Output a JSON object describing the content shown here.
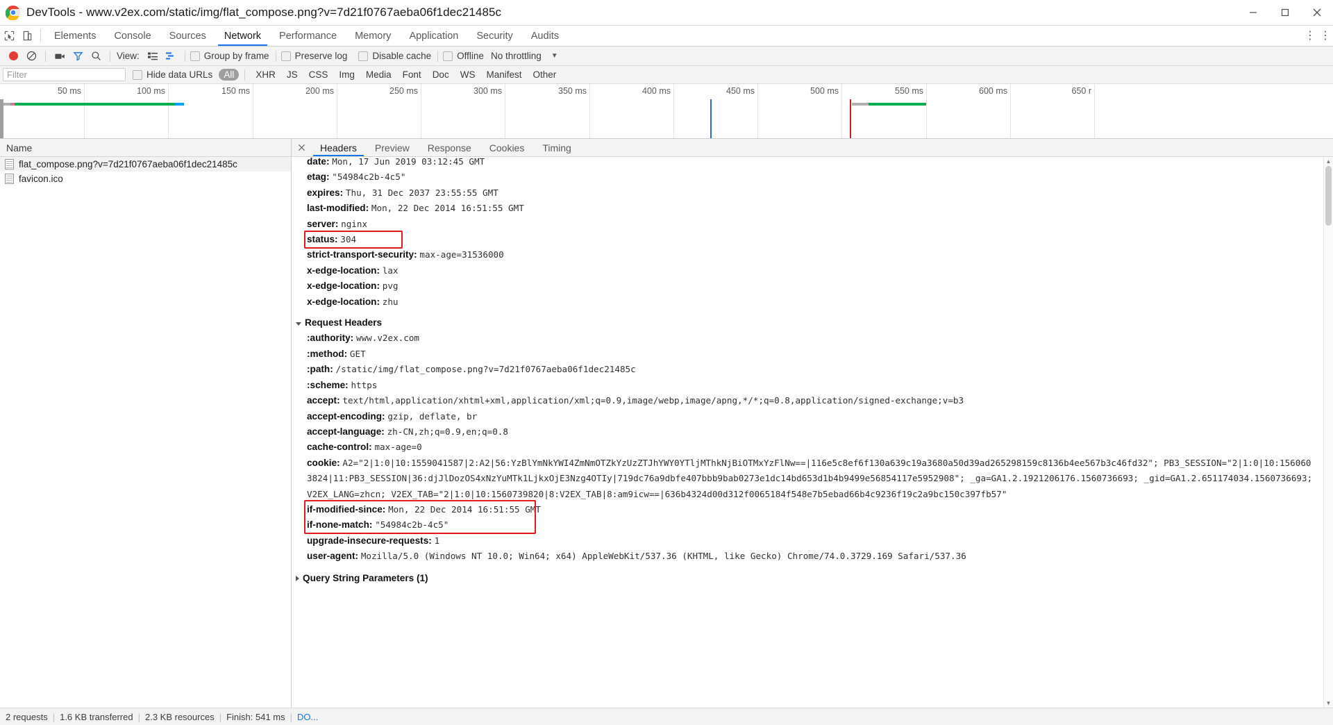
{
  "window": {
    "title": "DevTools - www.v2ex.com/static/img/flat_compose.png?v=7d21f0767aeba06f1dec21485c",
    "logo_icon": "chrome-logo-icon",
    "minimize_label": "Minimize",
    "maximize_label": "Maximize",
    "close_label": "Close"
  },
  "main_tabs": {
    "inspect_icon": "inspect-element-icon",
    "device_icon": "toggle-device-toolbar-icon",
    "items": [
      {
        "label": "Elements",
        "active": false
      },
      {
        "label": "Console",
        "active": false
      },
      {
        "label": "Sources",
        "active": false
      },
      {
        "label": "Network",
        "active": true
      },
      {
        "label": "Performance",
        "active": false
      },
      {
        "label": "Memory",
        "active": false
      },
      {
        "label": "Application",
        "active": false
      },
      {
        "label": "Security",
        "active": false
      },
      {
        "label": "Audits",
        "active": false
      }
    ],
    "more_icon": "more-vertical-icon",
    "menu_icon": "customize-devtools-icon"
  },
  "network_toolbar": {
    "record_icon": "record-stop-icon",
    "clear_icon": "clear-icon",
    "capture_screenshots_icon": "camera-icon",
    "filter_icon": "funnel-icon",
    "search_icon": "search-icon",
    "view_label": "View:",
    "list_view_icon": "list-view-icon",
    "waterfall_view_icon": "waterfall-view-icon",
    "group_by_frame_label": "Group by frame",
    "preserve_log_label": "Preserve log",
    "disable_cache_label": "Disable cache",
    "offline_label": "Offline",
    "throttling_label": "No throttling",
    "throttling_caret_icon": "chevron-down-icon"
  },
  "filter_bar": {
    "filter_placeholder": "Filter",
    "filter_value": "",
    "hide_data_urls_label": "Hide data URLs",
    "types": [
      {
        "label": "All",
        "active": true
      },
      {
        "label": "XHR",
        "active": false
      },
      {
        "label": "JS",
        "active": false
      },
      {
        "label": "CSS",
        "active": false
      },
      {
        "label": "Img",
        "active": false
      },
      {
        "label": "Media",
        "active": false
      },
      {
        "label": "Font",
        "active": false
      },
      {
        "label": "Doc",
        "active": false
      },
      {
        "label": "WS",
        "active": false
      },
      {
        "label": "Manifest",
        "active": false
      },
      {
        "label": "Other",
        "active": false
      }
    ]
  },
  "overview": {
    "ticks": [
      "50 ms",
      "100 ms",
      "150 ms",
      "200 ms",
      "250 ms",
      "300 ms",
      "350 ms",
      "400 ms",
      "450 ms",
      "500 ms",
      "550 ms",
      "600 ms",
      "650 r"
    ],
    "dom_content_loaded_color": "#1a6ed8",
    "load_color": "#c81e1e",
    "wait_color": "#b0b0b0",
    "receive_color": "#00b050",
    "ssl_color": "#00a0ff",
    "dns_color": "#c87b93"
  },
  "request_list": {
    "column_header": "Name",
    "rows": [
      {
        "name": "flat_compose.png?v=7d21f0767aeba06f1dec21485c",
        "icon": "image-file-icon",
        "selected": true
      },
      {
        "name": "favicon.ico",
        "icon": "image-file-icon",
        "selected": false
      }
    ]
  },
  "detail": {
    "close_icon": "close-icon",
    "tabs": [
      {
        "label": "Headers",
        "active": true
      },
      {
        "label": "Preview",
        "active": false
      },
      {
        "label": "Response",
        "active": false
      },
      {
        "label": "Cookies",
        "active": false
      },
      {
        "label": "Timing",
        "active": false
      }
    ],
    "response_headers": [
      {
        "key": "date:",
        "value": "Mon, 17 Jun 2019 03:12:45 GMT"
      },
      {
        "key": "etag:",
        "value": "\"54984c2b-4c5\""
      },
      {
        "key": "expires:",
        "value": "Thu, 31 Dec 2037 23:55:55 GMT"
      },
      {
        "key": "last-modified:",
        "value": "Mon, 22 Dec 2014 16:51:55 GMT"
      },
      {
        "key": "server:",
        "value": "nginx"
      },
      {
        "key": "status:",
        "value": "304"
      },
      {
        "key": "strict-transport-security:",
        "value": "max-age=31536000"
      },
      {
        "key": "x-edge-location:",
        "value": "lax"
      },
      {
        "key": "x-edge-location:",
        "value": "pvg"
      },
      {
        "key": "x-edge-location:",
        "value": "zhu"
      }
    ],
    "request_headers_title": "Request Headers",
    "request_headers": [
      {
        "key": ":authority:",
        "value": "www.v2ex.com"
      },
      {
        "key": ":method:",
        "value": "GET"
      },
      {
        "key": ":path:",
        "value": "/static/img/flat_compose.png?v=7d21f0767aeba06f1dec21485c"
      },
      {
        "key": ":scheme:",
        "value": "https"
      },
      {
        "key": "accept:",
        "value": "text/html,application/xhtml+xml,application/xml;q=0.9,image/webp,image/apng,*/*;q=0.8,application/signed-exchange;v=b3"
      },
      {
        "key": "accept-encoding:",
        "value": "gzip, deflate, br"
      },
      {
        "key": "accept-language:",
        "value": "zh-CN,zh;q=0.9,en;q=0.8"
      },
      {
        "key": "cache-control:",
        "value": "max-age=0"
      }
    ],
    "cookie_key": "cookie:",
    "cookie_value": "A2=\"2|1:0|10:1559041587|2:A2|56:YzBlYmNkYWI4ZmNmOTZkYzUzZTJhYWY0YTljMThkNjBiOTMxYzFlNw==|116e5c8ef6f130a639c19a3680a50d39ad265298159c8136b4ee567b3c46fd32\"; PB3_SESSION=\"2|1:0|10:1560603824|11:PB3_SESSION|36:djJlDozOS4xNzYuMTk1LjkxOjE3Nzg4OTIy|719dc76a9dbfe407bbb9bab0273e1dc14bd653d1b4b9499e56854117e5952908\"; _ga=GA1.2.1921206176.1560736693; _gid=GA1.2.651174034.1560736693; V2EX_LANG=zhcn; V2EX_TAB=\"2|1:0|10:1560739820|8:V2EX_TAB|8:am9icw==|636b4324d00d312f0065184f548e7b5ebad66b4c9236f19c2a9bc150c397fb57\"",
    "conditional_headers": [
      {
        "key": "if-modified-since:",
        "value": "Mon, 22 Dec 2014 16:51:55 GMT"
      },
      {
        "key": "if-none-match:",
        "value": "\"54984c2b-4c5\""
      }
    ],
    "tail_headers": [
      {
        "key": "upgrade-insecure-requests:",
        "value": "1"
      },
      {
        "key": "user-agent:",
        "value": "Mozilla/5.0 (Windows NT 10.0; Win64; x64) AppleWebKit/537.36 (KHTML, like Gecko) Chrome/74.0.3729.169 Safari/537.36"
      }
    ],
    "query_string_title": "Query String Parameters (1)",
    "highlight_color": "#e11b1b"
  },
  "status_bar": {
    "requests": "2 requests",
    "transferred": "1.6 KB transferred",
    "resources": "2.3 KB resources",
    "finish": "Finish: 541 ms",
    "dom": "DO..."
  }
}
